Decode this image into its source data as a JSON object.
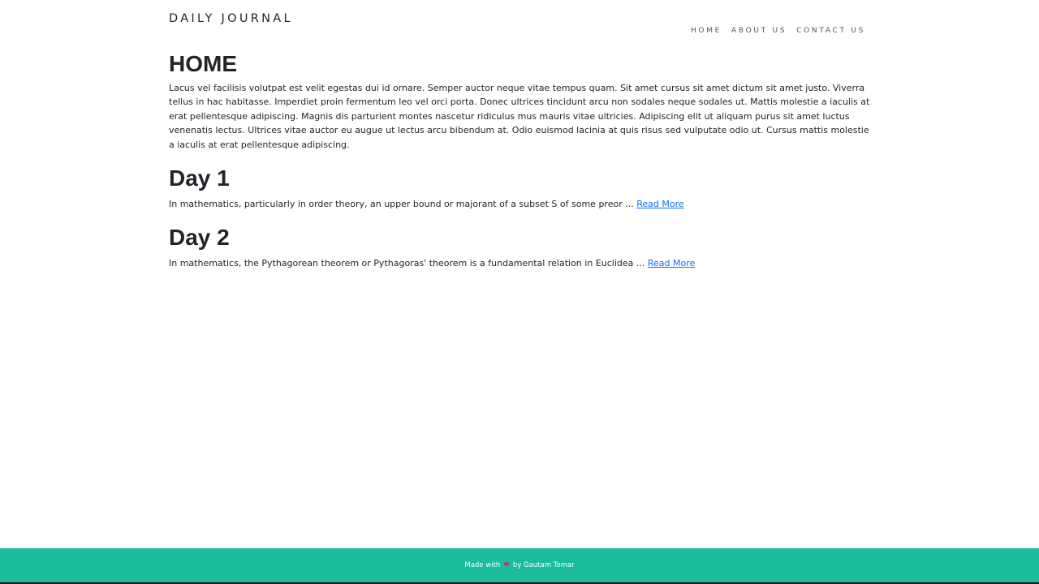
{
  "navbar": {
    "brand": "DAILY JOURNAL",
    "links": [
      "HOME",
      "ABOUT US",
      "CONTACT US"
    ]
  },
  "home": {
    "title": "HOME",
    "text": "Lacus vel facilisis volutpat est velit egestas dui id ornare. Semper auctor neque vitae tempus quam. Sit amet cursus sit amet dictum sit amet justo. Viverra tellus in hac habitasse. Imperdiet proin fermentum leo vel orci porta. Donec ultrices tincidunt arcu non sodales neque sodales ut. Mattis molestie a iaculis at erat pellentesque adipiscing. Magnis dis parturient montes nascetur ridiculus mus mauris vitae ultricies. Adipiscing elit ut aliquam purus sit amet luctus venenatis lectus. Ultrices vitae auctor eu augue ut lectus arcu bibendum at. Odio euismod lacinia at quis risus sed vulputate odio ut. Cursus mattis molestie a iaculis at erat pellentesque adipiscing."
  },
  "posts": [
    {
      "title": "Day 1",
      "excerpt": "In mathematics, particularly in order theory, an upper bound or majorant of a subset S of some preor ... ",
      "read_more": "Read More"
    },
    {
      "title": "Day 2",
      "excerpt": "In mathematics, the Pythagorean theorem or Pythagoras' theorem is a fundamental relation in Euclidea ... ",
      "read_more": "Read More"
    }
  ],
  "footer": {
    "prefix": "Made with",
    "icon": "heart-icon",
    "suffix": "by Gautam Tomar",
    "background": "#1abc9c",
    "heart_color": "#e0245e"
  },
  "colors": {
    "link": "#0d6efd",
    "text": "#212529"
  }
}
